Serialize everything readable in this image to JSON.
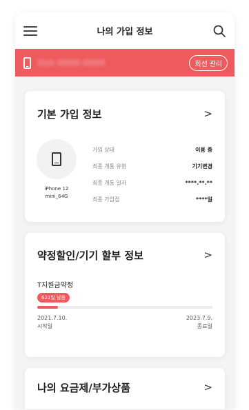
{
  "header": {
    "title": "나의 가입 정보",
    "menu_icon": "hamburger-menu-icon",
    "search_icon": "search-icon"
  },
  "line_bar": {
    "phone_number": "010-0000-0000",
    "manage_label": "회선 관리",
    "color": "#ee5a5e"
  },
  "basic_info": {
    "title": "기본 가입 정보",
    "chevron": ">",
    "device_model": "iPhone 12 mini_64G",
    "rows": [
      {
        "label": "가입 상태",
        "value": "이용 중"
      },
      {
        "label": "최종 개통 유형",
        "value": "기기변경"
      },
      {
        "label": "최종 개통 일자",
        "value": "****.**.**"
      },
      {
        "label": "최종 가입점",
        "value": "****일"
      }
    ]
  },
  "contract_info": {
    "title": "약정할인/기기 할부 정보",
    "chevron": ">",
    "plan_name": "T지원금약정",
    "badge": "621일 남음",
    "progress": 0.12,
    "start_date": "2021.7.10.",
    "start_label": "시작일",
    "end_date": "2023.7.9.",
    "end_label": "종료일"
  },
  "plan_info": {
    "title": "나의 요금제/부가상품",
    "chevron": ">"
  }
}
